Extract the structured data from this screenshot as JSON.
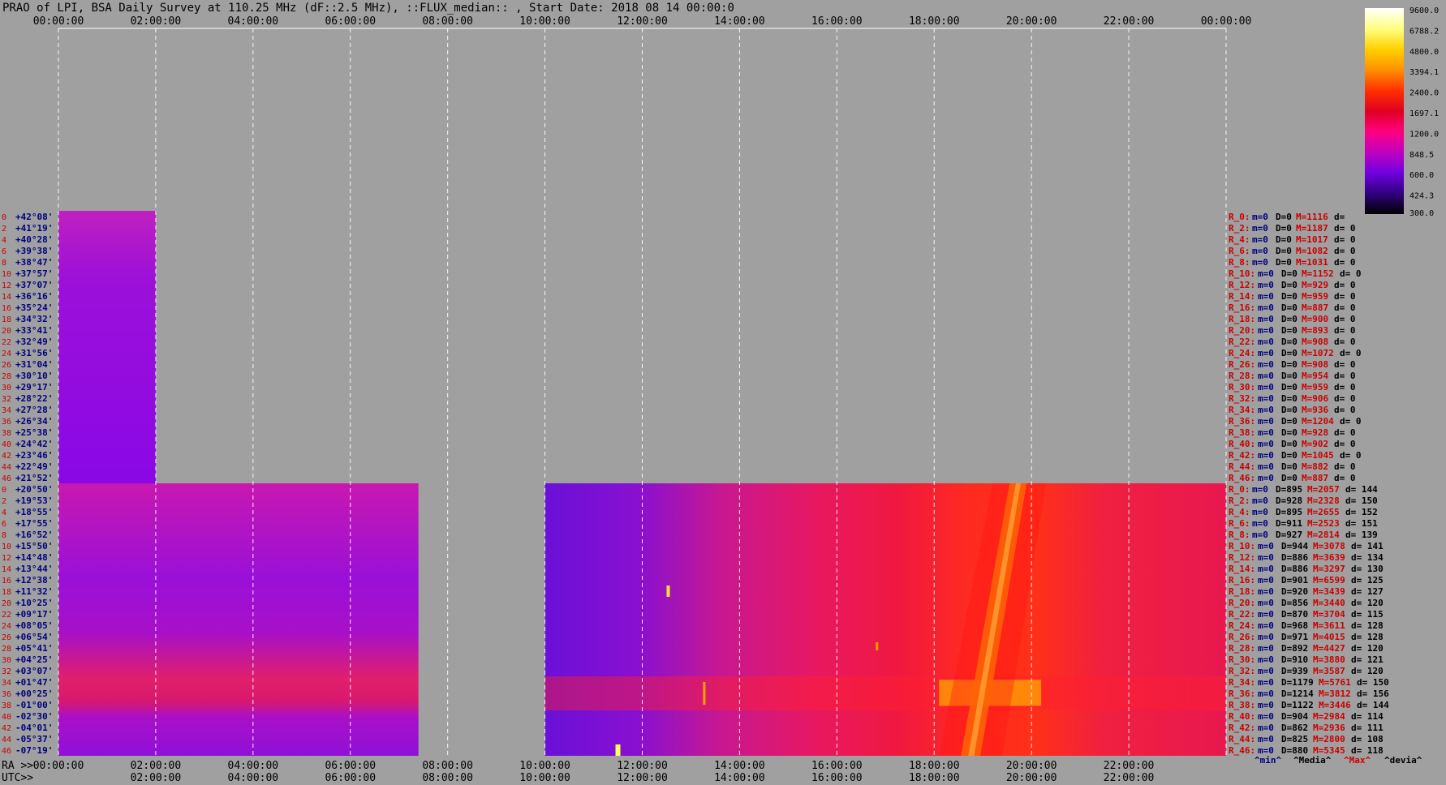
{
  "title": "PRAO of LPI, BSA Daily Survey at 110.25 MHz (dF::2.5 MHz), ::FLUX_median:: , Start Date: 2018 08 14 00:00:0",
  "colors": {
    "background": "#a0a0a0",
    "grid": "#ffffff",
    "left_labels_index": "#cc0000",
    "left_labels_dec": "#000080",
    "stat_label": "#cc0000",
    "stat_min": "#000080",
    "stat_max": "#cc0000"
  },
  "chart_data": {
    "type": "heatmap",
    "x_unit": "UTC hours",
    "xlim": [
      0,
      24
    ],
    "top_axis_ticks": [
      "00:00:00",
      "02:00:00",
      "04:00:00",
      "06:00:00",
      "08:00:00",
      "10:00:00",
      "12:00:00",
      "14:00:00",
      "16:00:00",
      "18:00:00",
      "20:00:00",
      "22:00:00",
      "00:00:00"
    ],
    "bottom_axis_ra_prefix": "RA >>",
    "bottom_axis_ra_ticks": [
      "00:00:00",
      "02:00:00",
      "04:00:00",
      "06:00:00",
      "08:00:00",
      "10:00:00",
      "12:00:00",
      "14:00:00",
      "16:00:00",
      "18:00:00",
      "20:00:00",
      "22:00:00"
    ],
    "bottom_axis_utc_prefix": "UTC>>",
    "bottom_axis_utc_ticks": [
      "02:00:00",
      "04:00:00",
      "06:00:00",
      "08:00:00",
      "10:00:00",
      "12:00:00",
      "14:00:00",
      "16:00:00",
      "18:00:00",
      "20:00:00",
      "22:00:00"
    ],
    "colorbar": {
      "ticks": [
        "9600.0",
        "6788.2",
        "4800.0",
        "3394.1",
        "2400.0",
        "1697.1",
        "1200.0",
        "848.5",
        "600.0",
        "424.3",
        "300.0"
      ],
      "colors": [
        "#ffffff",
        "#ffff80",
        "#ffd000",
        "#ff9000",
        "#ff3000",
        "#e00020",
        "#ff0080",
        "#c000c0",
        "#7000e0",
        "#300080",
        "#000000"
      ]
    },
    "upper_block": {
      "x_range": [
        0,
        2
      ],
      "rows": [
        {
          "idx": "0",
          "dec": "+42°08'"
        },
        {
          "idx": "2",
          "dec": "+41°19'"
        },
        {
          "idx": "4",
          "dec": "+40°28'"
        },
        {
          "idx": "6",
          "dec": "+39°38'"
        },
        {
          "idx": "8",
          "dec": "+38°47'"
        },
        {
          "idx": "10",
          "dec": "+37°57'"
        },
        {
          "idx": "12",
          "dec": "+37°07'"
        },
        {
          "idx": "14",
          "dec": "+36°16'"
        },
        {
          "idx": "16",
          "dec": "+35°24'"
        },
        {
          "idx": "18",
          "dec": "+34°32'"
        },
        {
          "idx": "20",
          "dec": "+33°41'"
        },
        {
          "idx": "22",
          "dec": "+32°49'"
        },
        {
          "idx": "24",
          "dec": "+31°56'"
        },
        {
          "idx": "26",
          "dec": "+31°04'"
        },
        {
          "idx": "28",
          "dec": "+30°10'"
        },
        {
          "idx": "30",
          "dec": "+29°17'"
        },
        {
          "idx": "32",
          "dec": "+28°22'"
        },
        {
          "idx": "34",
          "dec": "+27°28'"
        },
        {
          "idx": "36",
          "dec": "+26°34'"
        },
        {
          "idx": "38",
          "dec": "+25°38'"
        },
        {
          "idx": "40",
          "dec": "+24°42'"
        },
        {
          "idx": "42",
          "dec": "+23°46'"
        },
        {
          "idx": "44",
          "dec": "+22°49'"
        },
        {
          "idx": "46",
          "dec": "+21°52'"
        }
      ],
      "stats": [
        {
          "label": "R_0:",
          "m": "m=0",
          "D": "D=0",
          "M": "M=1116",
          "d": "d="
        },
        {
          "label": "R_2:",
          "m": "m=0",
          "D": "D=0",
          "M": "M=1187",
          "d": "d= 0"
        },
        {
          "label": "R_4:",
          "m": "m=0",
          "D": "D=0",
          "M": "M=1017",
          "d": "d= 0"
        },
        {
          "label": "R_6:",
          "m": "m=0",
          "D": "D=0",
          "M": "M=1082",
          "d": "d= 0"
        },
        {
          "label": "R_8:",
          "m": "m=0",
          "D": "D=0",
          "M": "M=1031",
          "d": "d= 0"
        },
        {
          "label": "R_10:",
          "m": "m=0",
          "D": "D=0",
          "M": "M=1152",
          "d": "d= 0"
        },
        {
          "label": "R_12:",
          "m": "m=0",
          "D": "D=0",
          "M": "M=929",
          "d": "d= 0"
        },
        {
          "label": "R_14:",
          "m": "m=0",
          "D": "D=0",
          "M": "M=959",
          "d": "d= 0"
        },
        {
          "label": "R_16:",
          "m": "m=0",
          "D": "D=0",
          "M": "M=887",
          "d": "d= 0"
        },
        {
          "label": "R_18:",
          "m": "m=0",
          "D": "D=0",
          "M": "M=900",
          "d": "d= 0"
        },
        {
          "label": "R_20:",
          "m": "m=0",
          "D": "D=0",
          "M": "M=893",
          "d": "d= 0"
        },
        {
          "label": "R_22:",
          "m": "m=0",
          "D": "D=0",
          "M": "M=908",
          "d": "d= 0"
        },
        {
          "label": "R_24:",
          "m": "m=0",
          "D": "D=0",
          "M": "M=1072",
          "d": "d= 0"
        },
        {
          "label": "R_26:",
          "m": "m=0",
          "D": "D=0",
          "M": "M=908",
          "d": "d= 0"
        },
        {
          "label": "R_28:",
          "m": "m=0",
          "D": "D=0",
          "M": "M=954",
          "d": "d= 0"
        },
        {
          "label": "R_30:",
          "m": "m=0",
          "D": "D=0",
          "M": "M=959",
          "d": "d= 0"
        },
        {
          "label": "R_32:",
          "m": "m=0",
          "D": "D=0",
          "M": "M=906",
          "d": "d= 0"
        },
        {
          "label": "R_34:",
          "m": "m=0",
          "D": "D=0",
          "M": "M=936",
          "d": "d= 0"
        },
        {
          "label": "R_36:",
          "m": "m=0",
          "D": "D=0",
          "M": "M=1204",
          "d": "d= 0"
        },
        {
          "label": "R_38:",
          "m": "m=0",
          "D": "D=0",
          "M": "M=928",
          "d": "d= 0"
        },
        {
          "label": "R_40:",
          "m": "m=0",
          "D": "D=0",
          "M": "M=902",
          "d": "d= 0"
        },
        {
          "label": "R_42:",
          "m": "m=0",
          "D": "D=0",
          "M": "M=1045",
          "d": "d= 0"
        },
        {
          "label": "R_44:",
          "m": "m=0",
          "D": "D=0",
          "M": "M=882",
          "d": "d= 0"
        },
        {
          "label": "R_46:",
          "m": "m=0",
          "D": "D=0",
          "M": "M=887",
          "d": "d= 0"
        }
      ]
    },
    "lower_block": {
      "segments": [
        [
          0,
          7.4
        ],
        [
          10,
          24
        ]
      ],
      "rows": [
        {
          "idx": "0",
          "dec": "+20°50'"
        },
        {
          "idx": "2",
          "dec": "+19°53'"
        },
        {
          "idx": "4",
          "dec": "+18°55'"
        },
        {
          "idx": "6",
          "dec": "+17°55'"
        },
        {
          "idx": "8",
          "dec": "+16°52'"
        },
        {
          "idx": "10",
          "dec": "+15°50'"
        },
        {
          "idx": "12",
          "dec": "+14°48'"
        },
        {
          "idx": "14",
          "dec": "+13°44'"
        },
        {
          "idx": "16",
          "dec": "+12°38'"
        },
        {
          "idx": "18",
          "dec": "+11°32'"
        },
        {
          "idx": "20",
          "dec": "+10°25'"
        },
        {
          "idx": "22",
          "dec": "+09°17'"
        },
        {
          "idx": "24",
          "dec": "+08°05'"
        },
        {
          "idx": "26",
          "dec": "+06°54'"
        },
        {
          "idx": "28",
          "dec": "+05°41'"
        },
        {
          "idx": "30",
          "dec": "+04°25'"
        },
        {
          "idx": "32",
          "dec": "+03°07'"
        },
        {
          "idx": "34",
          "dec": "+01°47'"
        },
        {
          "idx": "36",
          "dec": "+00°25'"
        },
        {
          "idx": "38",
          "dec": "-01°00'"
        },
        {
          "idx": "40",
          "dec": "-02°30'"
        },
        {
          "idx": "42",
          "dec": "-04°01'"
        },
        {
          "idx": "44",
          "dec": "-05°37'"
        },
        {
          "idx": "46",
          "dec": "-07°19'"
        }
      ],
      "stats": [
        {
          "label": "R_0:",
          "m": "m=0",
          "D": "D=895",
          "M": "M=2057",
          "d": "d= 144"
        },
        {
          "label": "R_2:",
          "m": "m=0",
          "D": "D=928",
          "M": "M=2328",
          "d": "d= 150"
        },
        {
          "label": "R_4:",
          "m": "m=0",
          "D": "D=895",
          "M": "M=2655",
          "d": "d= 152"
        },
        {
          "label": "R_6:",
          "m": "m=0",
          "D": "D=911",
          "M": "M=2523",
          "d": "d= 151"
        },
        {
          "label": "R_8:",
          "m": "m=0",
          "D": "D=927",
          "M": "M=2814",
          "d": "d= 139"
        },
        {
          "label": "R_10:",
          "m": "m=0",
          "D": "D=944",
          "M": "M=3078",
          "d": "d= 141"
        },
        {
          "label": "R_12:",
          "m": "m=0",
          "D": "D=886",
          "M": "M=3639",
          "d": "d= 134"
        },
        {
          "label": "R_14:",
          "m": "m=0",
          "D": "D=886",
          "M": "M=3297",
          "d": "d= 130"
        },
        {
          "label": "R_16:",
          "m": "m=0",
          "D": "D=901",
          "M": "M=6599",
          "d": "d= 125"
        },
        {
          "label": "R_18:",
          "m": "m=0",
          "D": "D=920",
          "M": "M=3439",
          "d": "d= 127"
        },
        {
          "label": "R_20:",
          "m": "m=0",
          "D": "D=856",
          "M": "M=3440",
          "d": "d= 120"
        },
        {
          "label": "R_22:",
          "m": "m=0",
          "D": "D=870",
          "M": "M=3704",
          "d": "d= 115"
        },
        {
          "label": "R_24:",
          "m": "m=0",
          "D": "D=968",
          "M": "M=3611",
          "d": "d= 128"
        },
        {
          "label": "R_26:",
          "m": "m=0",
          "D": "D=971",
          "M": "M=4015",
          "d": "d= 128"
        },
        {
          "label": "R_28:",
          "m": "m=0",
          "D": "D=892",
          "M": "M=4427",
          "d": "d= 120"
        },
        {
          "label": "R_30:",
          "m": "m=0",
          "D": "D=910",
          "M": "M=3880",
          "d": "d= 121"
        },
        {
          "label": "R_32:",
          "m": "m=0",
          "D": "D=939",
          "M": "M=3587",
          "d": "d= 120"
        },
        {
          "label": "R_34:",
          "m": "m=0",
          "D": "D=1179",
          "M": "M=5761",
          "d": "d= 150"
        },
        {
          "label": "R_36:",
          "m": "m=0",
          "D": "D=1214",
          "M": "M=3812",
          "d": "d= 156"
        },
        {
          "label": "R_38:",
          "m": "m=0",
          "D": "D=1122",
          "M": "M=3446",
          "d": "d= 144"
        },
        {
          "label": "R_40:",
          "m": "m=0",
          "D": "D=904",
          "M": "M=2984",
          "d": "d= 114"
        },
        {
          "label": "R_42:",
          "m": "m=0",
          "D": "D=862",
          "M": "M=2936",
          "d": "d= 111"
        },
        {
          "label": "R_44:",
          "m": "m=0",
          "D": "D=825",
          "M": "M=2800",
          "d": "d= 108"
        },
        {
          "label": "R_46:",
          "m": "m=0",
          "D": "D=880",
          "M": "M=5345",
          "d": "d= 118"
        }
      ]
    },
    "stats_legend": [
      "^min^",
      "^Media^",
      "^Max^",
      "^devia^"
    ]
  }
}
